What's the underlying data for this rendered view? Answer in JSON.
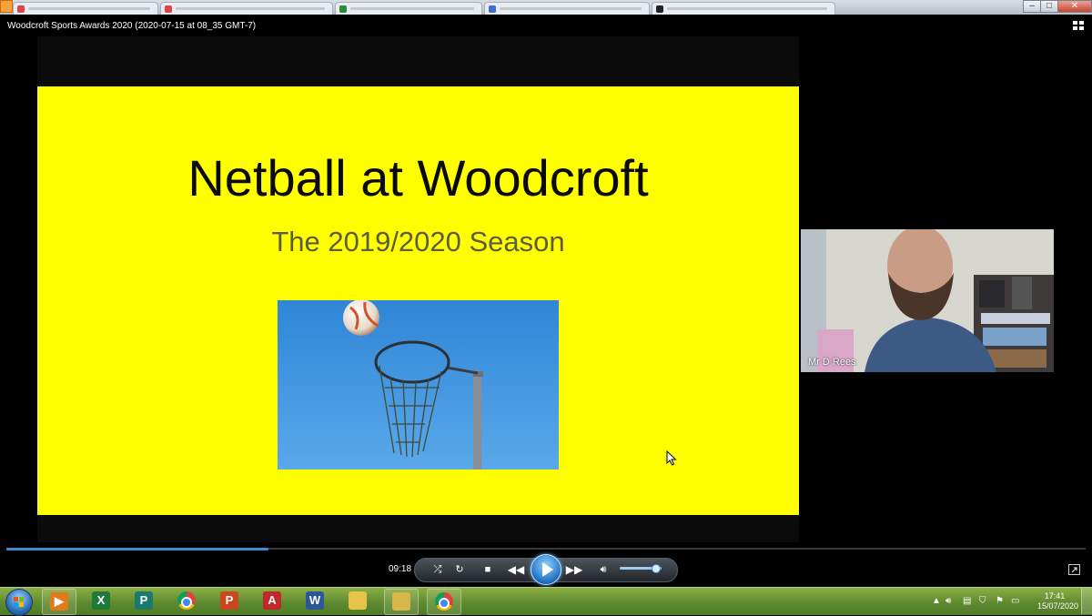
{
  "window": {
    "title": "Woodcroft Sports Awards 2020 (2020-07-15 at 08_35 GMT-7)"
  },
  "slide": {
    "title": "Netball at Woodcroft",
    "subtitle": "The 2019/2020 Season",
    "background_color": "#ffff00"
  },
  "participant": {
    "name": "Mr D Rees"
  },
  "player": {
    "current_time": "09:18",
    "progress_fraction": 0.243,
    "volume_fraction": 0.85
  },
  "taskbar": {
    "apps": [
      {
        "name": "media-player",
        "color": "#e07a1a",
        "glyph": "▶"
      },
      {
        "name": "excel",
        "color": "#1f7a3a",
        "glyph": "X"
      },
      {
        "name": "publisher",
        "color": "#1a7a6e",
        "glyph": "P"
      },
      {
        "name": "chrome",
        "color": "#db4437",
        "glyph": ""
      },
      {
        "name": "powerpoint",
        "color": "#c8471c",
        "glyph": "P"
      },
      {
        "name": "pdf-viewer",
        "color": "#c0282a",
        "glyph": "A"
      },
      {
        "name": "word",
        "color": "#2b579a",
        "glyph": "W"
      },
      {
        "name": "file-explorer",
        "color": "#e8c34a",
        "glyph": ""
      },
      {
        "name": "folder",
        "color": "#d9b64a",
        "glyph": ""
      },
      {
        "name": "chrome-active",
        "color": "#db4437",
        "glyph": ""
      }
    ],
    "clock_time": "17:41",
    "clock_date": "15/07/2020"
  },
  "colors": {
    "accent": "#3f8bd6",
    "taskbar": "#6b9636"
  }
}
